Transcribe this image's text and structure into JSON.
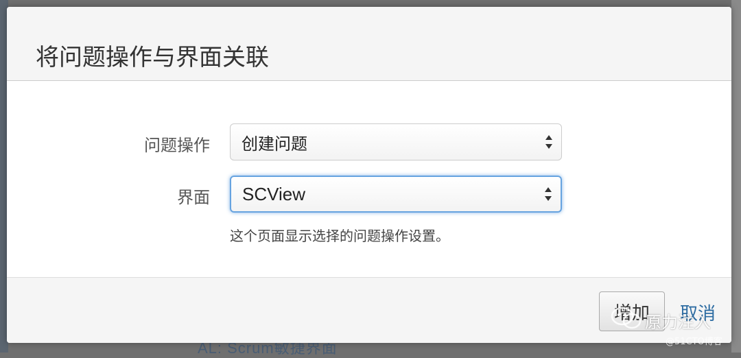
{
  "dialog": {
    "title": "将问题操作与界面关联",
    "issue_operation": {
      "label": "问题操作",
      "selected": "创建问题"
    },
    "screen": {
      "label": "界面",
      "selected": "SCView"
    },
    "hint": "这个页面显示选择的问题操作设置。",
    "add_button": "增加",
    "cancel_link": "取消"
  },
  "background": {
    "partial_text": "AL: Scrum敏捷界面"
  },
  "watermark": {
    "name": "原力注入",
    "site": "@51CTO博客",
    "icon": "wechat-icon"
  },
  "colors": {
    "focus_border": "#66a3e0",
    "link": "#2d6ca2"
  }
}
